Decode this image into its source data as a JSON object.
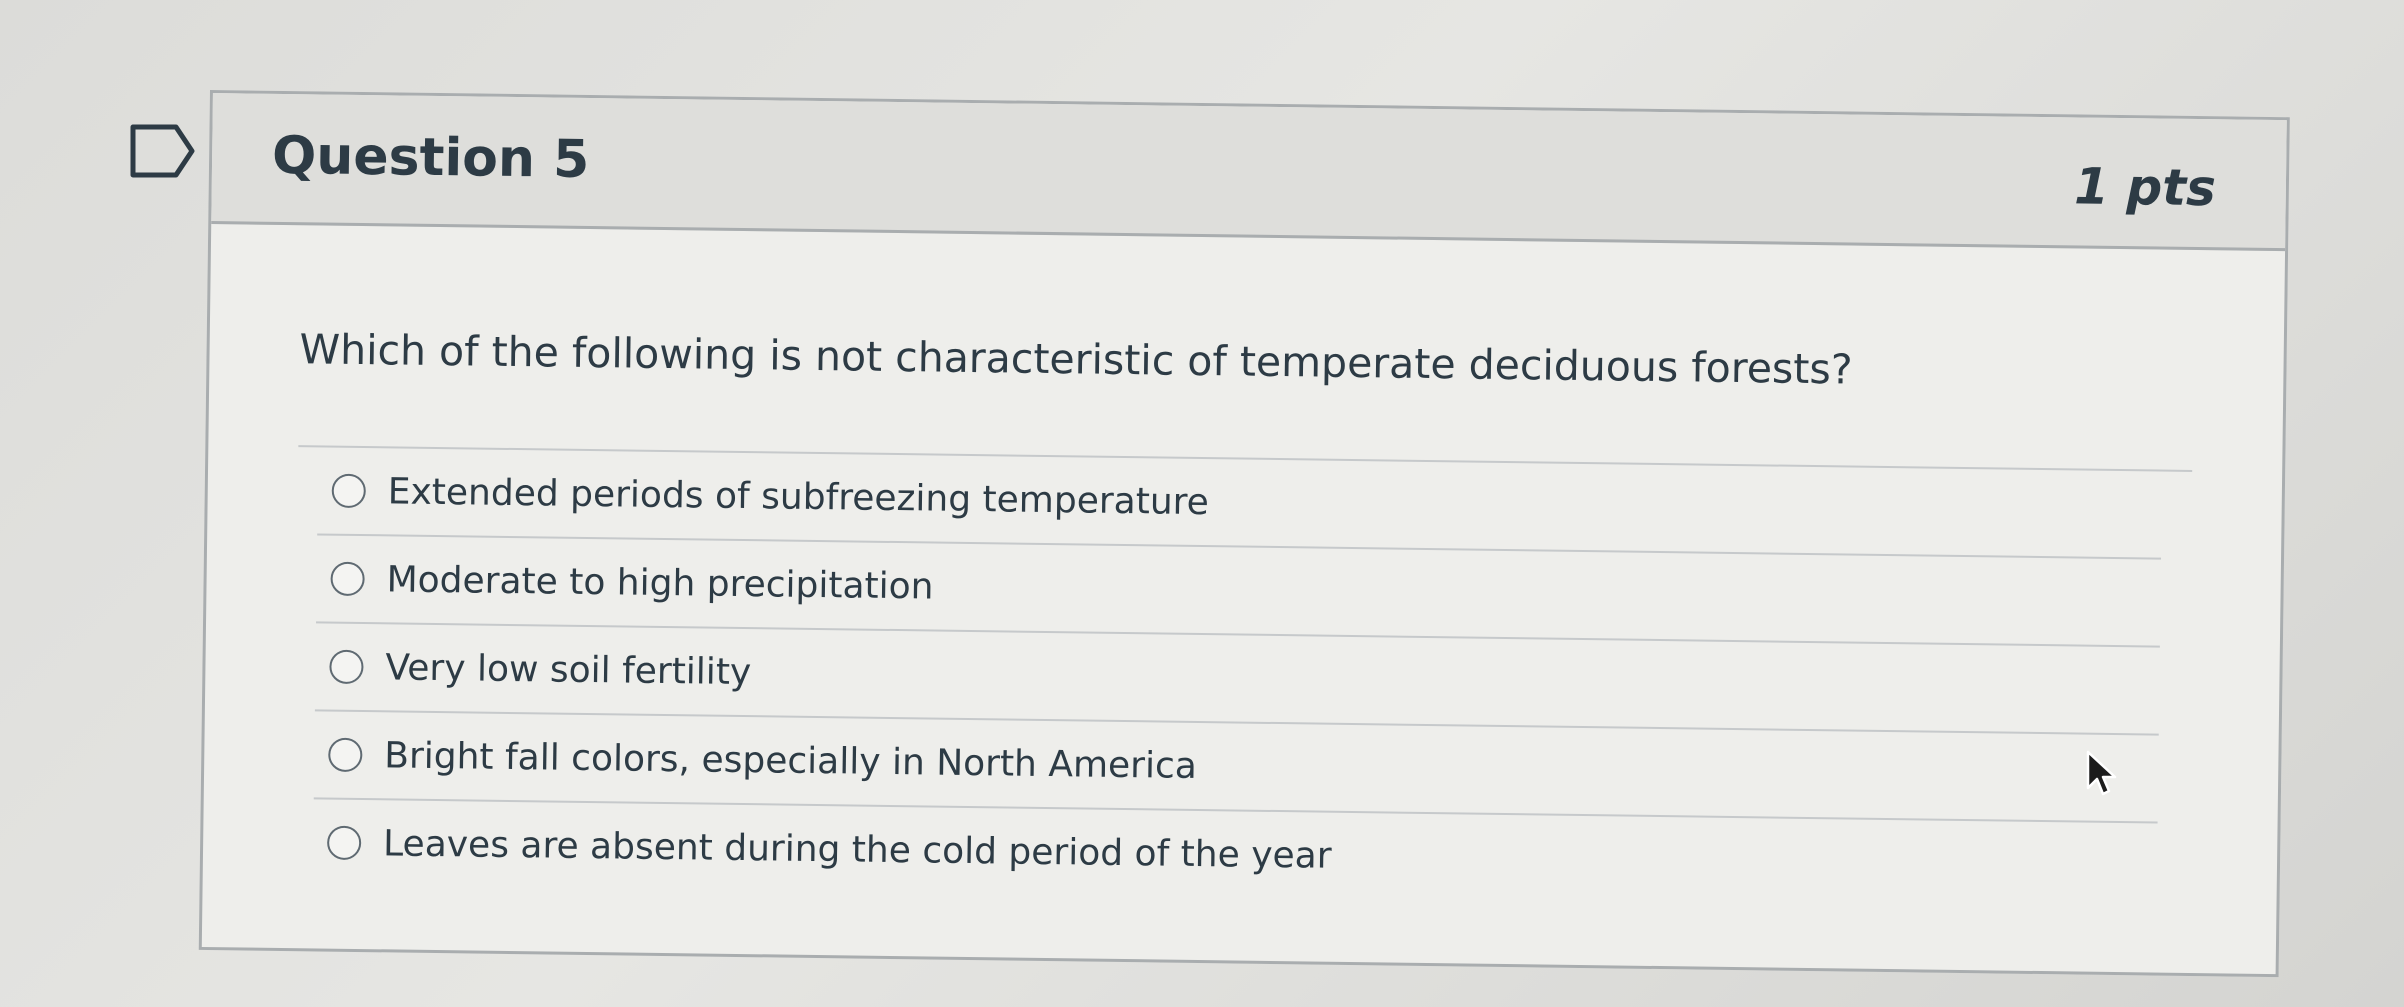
{
  "question": {
    "title": "Question 5",
    "points": "1 pts",
    "prompt": "Which of the following is not characteristic of temperate deciduous forests?",
    "answers": [
      {
        "label": "Extended periods of subfreezing temperature",
        "selected": false
      },
      {
        "label": "Moderate to high precipitation",
        "selected": false
      },
      {
        "label": "Very low soil fertility",
        "selected": false
      },
      {
        "label": "Bright fall colors, especially in North America",
        "selected": false
      },
      {
        "label": "Leaves are absent during the cold period of the year",
        "selected": false
      }
    ]
  },
  "icons": {
    "flag": "flag-outline-icon",
    "cursor": "mouse-pointer-icon"
  },
  "colors": {
    "text": "#2d3b45",
    "border": "#a9adaf",
    "header_bg": "#dededb",
    "card_bg": "#eeeeeb"
  }
}
